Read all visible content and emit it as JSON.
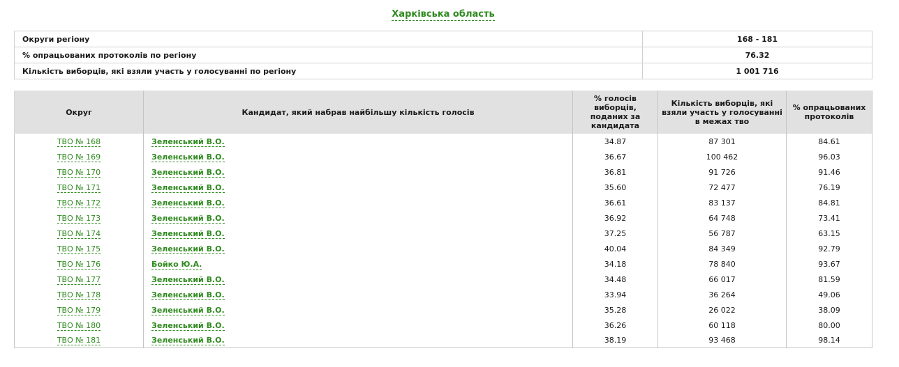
{
  "region": {
    "title": "Харківська область"
  },
  "summary": [
    {
      "label": "Округи регіону",
      "value": "168 - 181"
    },
    {
      "label": "% опрацьованих протоколів по регіону",
      "value": "76.32"
    },
    {
      "label": "Кількість виборців, які взяли участь у голосуванні по регіону",
      "value": "1 001 716"
    }
  ],
  "headers": {
    "district": "Округ",
    "candidate": "Кандидат, який набрав найбільшу кількість голосів",
    "vote_pct": "% голосів виборців, поданих за кандидата",
    "turnout": "Кількість виборців, які взяли участь у голосуванні в межах тво",
    "protocols_pct": "% опрацьованих протоколів"
  },
  "rows": [
    {
      "district": "ТВО № 168",
      "candidate": "Зеленський В.О.",
      "vote_pct": "34.87",
      "turnout": "87 301",
      "protocols_pct": "84.61"
    },
    {
      "district": "ТВО № 169",
      "candidate": "Зеленський В.О.",
      "vote_pct": "36.67",
      "turnout": "100 462",
      "protocols_pct": "96.03"
    },
    {
      "district": "ТВО № 170",
      "candidate": "Зеленський В.О.",
      "vote_pct": "36.81",
      "turnout": "91 726",
      "protocols_pct": "91.46"
    },
    {
      "district": "ТВО № 171",
      "candidate": "Зеленський В.О.",
      "vote_pct": "35.60",
      "turnout": "72 477",
      "protocols_pct": "76.19"
    },
    {
      "district": "ТВО № 172",
      "candidate": "Зеленський В.О.",
      "vote_pct": "36.61",
      "turnout": "83 137",
      "protocols_pct": "84.81"
    },
    {
      "district": "ТВО № 173",
      "candidate": "Зеленський В.О.",
      "vote_pct": "36.92",
      "turnout": "64 748",
      "protocols_pct": "73.41"
    },
    {
      "district": "ТВО № 174",
      "candidate": "Зеленський В.О.",
      "vote_pct": "37.25",
      "turnout": "56 787",
      "protocols_pct": "63.15"
    },
    {
      "district": "ТВО № 175",
      "candidate": "Зеленський В.О.",
      "vote_pct": "40.04",
      "turnout": "84 349",
      "protocols_pct": "92.79"
    },
    {
      "district": "ТВО № 176",
      "candidate": "Бойко Ю.А.",
      "vote_pct": "34.18",
      "turnout": "78 840",
      "protocols_pct": "93.67"
    },
    {
      "district": "ТВО № 177",
      "candidate": "Зеленський В.О.",
      "vote_pct": "34.48",
      "turnout": "66 017",
      "protocols_pct": "81.59"
    },
    {
      "district": "ТВО № 178",
      "candidate": "Зеленський В.О.",
      "vote_pct": "33.94",
      "turnout": "36 264",
      "protocols_pct": "49.06"
    },
    {
      "district": "ТВО № 179",
      "candidate": "Зеленський В.О.",
      "vote_pct": "35.28",
      "turnout": "26 022",
      "protocols_pct": "38.09"
    },
    {
      "district": "ТВО № 180",
      "candidate": "Зеленський В.О.",
      "vote_pct": "36.26",
      "turnout": "60 118",
      "protocols_pct": "80.00"
    },
    {
      "district": "ТВО № 181",
      "candidate": "Зеленський В.О.",
      "vote_pct": "38.19",
      "turnout": "93 468",
      "protocols_pct": "98.14"
    }
  ],
  "colors": {
    "link": "#2f8a1f",
    "header_bg": "#e1e1e1",
    "border": "#c4c4c4"
  }
}
